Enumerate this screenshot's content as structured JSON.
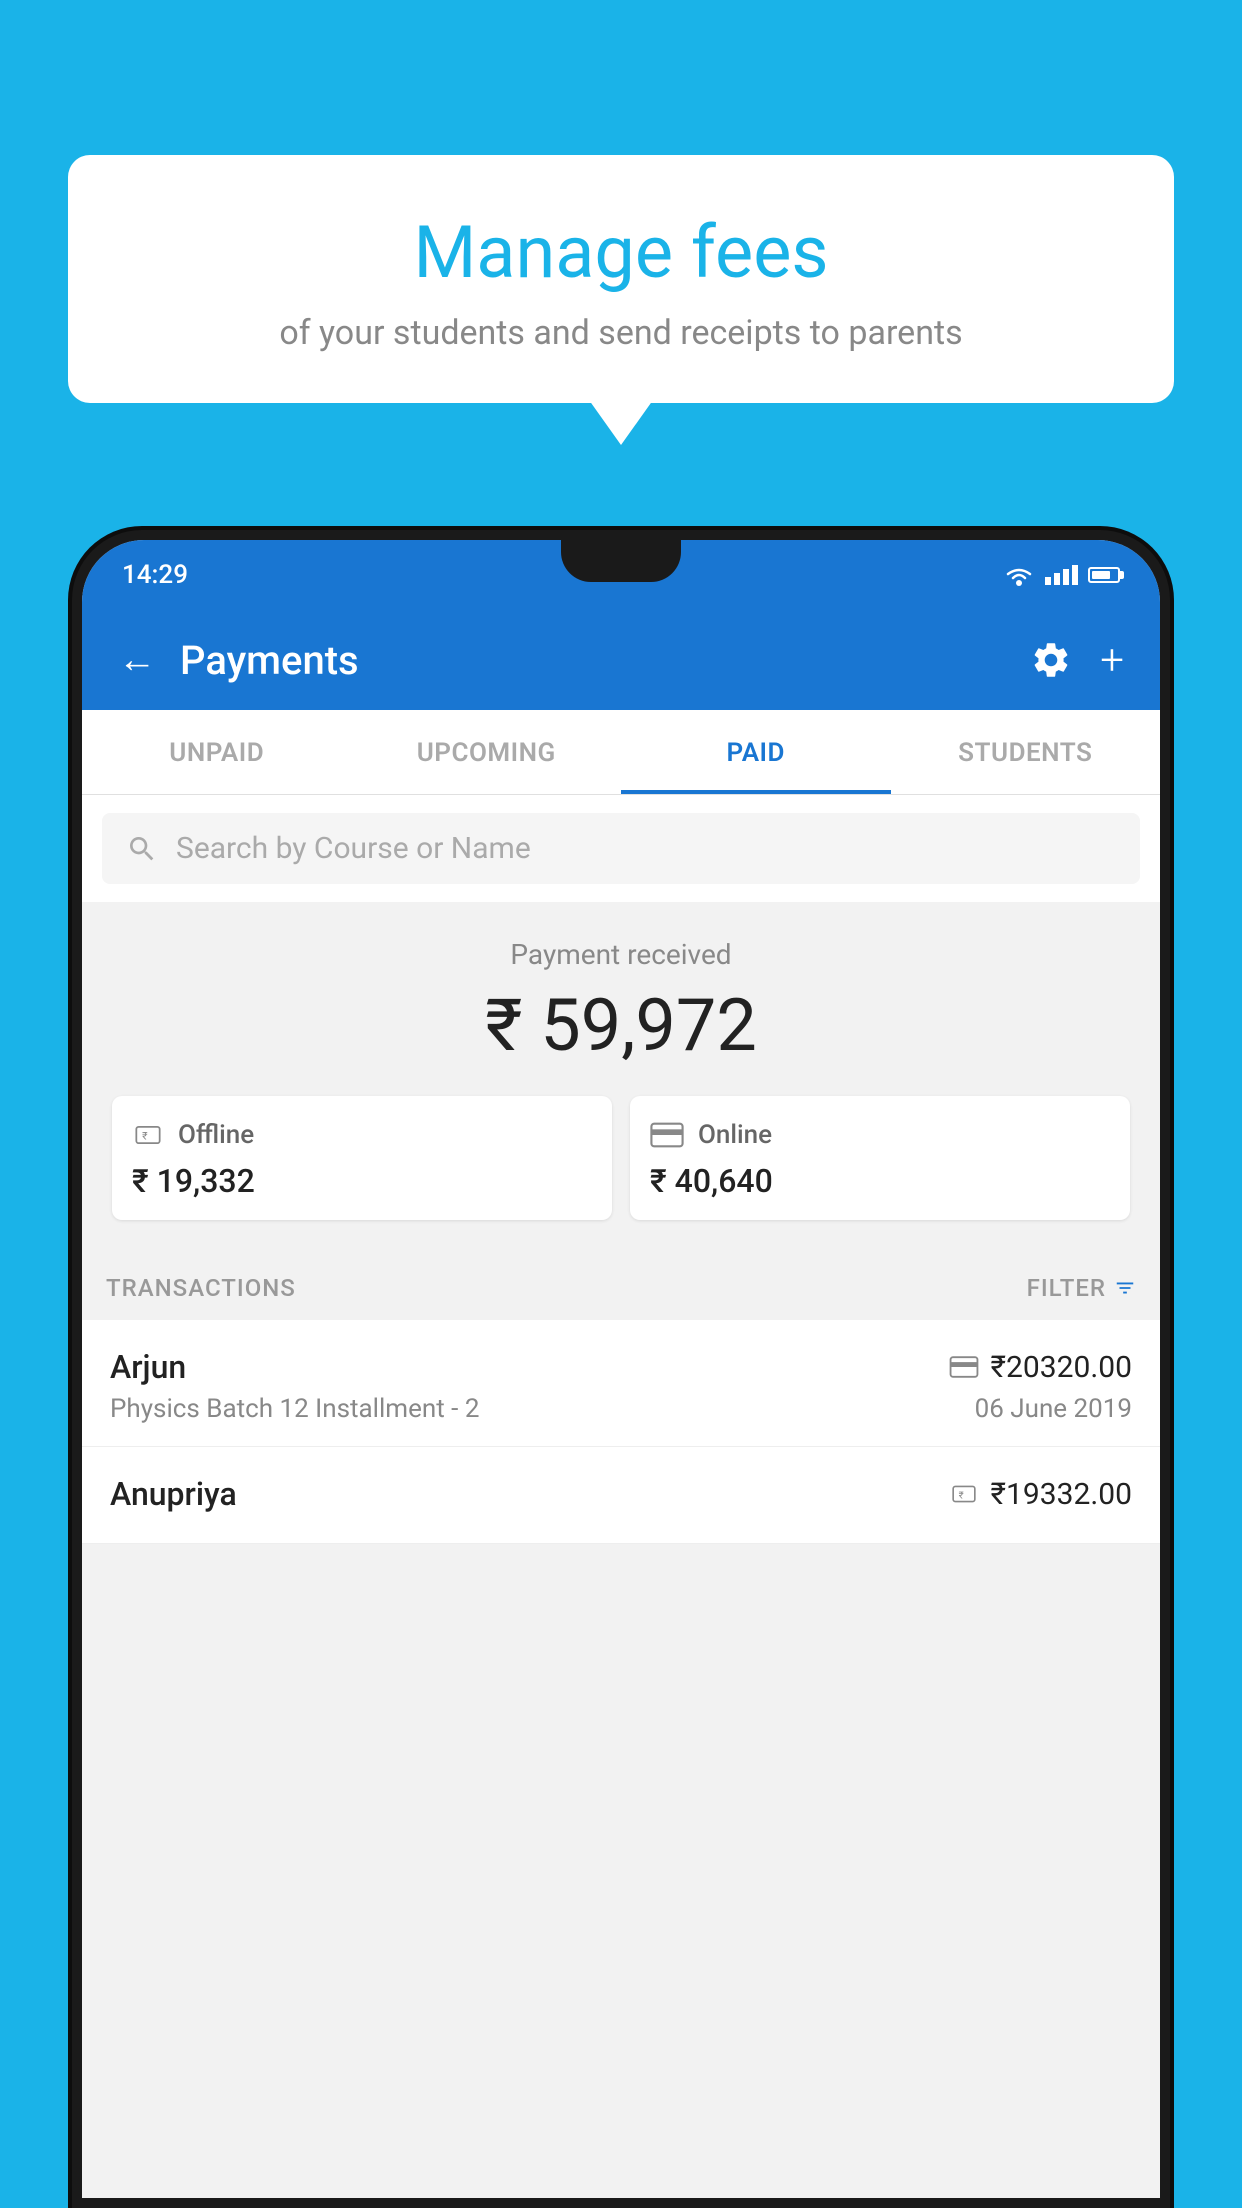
{
  "background_color": "#1ab3e8",
  "speech_bubble": {
    "title": "Manage fees",
    "subtitle": "of your students and send receipts to parents"
  },
  "status_bar": {
    "time": "14:29",
    "wifi_icon": "wifi",
    "signal_icon": "signal",
    "battery_icon": "battery"
  },
  "app_header": {
    "back_label": "←",
    "title": "Payments",
    "gear_icon": "gear",
    "plus_icon": "+"
  },
  "tabs": [
    {
      "label": "UNPAID",
      "active": false
    },
    {
      "label": "UPCOMING",
      "active": false
    },
    {
      "label": "PAID",
      "active": true
    },
    {
      "label": "STUDENTS",
      "active": false
    }
  ],
  "search": {
    "placeholder": "Search by Course or Name"
  },
  "payment_summary": {
    "label": "Payment received",
    "total_amount": "₹ 59,972",
    "offline": {
      "label": "Offline",
      "amount": "₹ 19,332"
    },
    "online": {
      "label": "Online",
      "amount": "₹ 40,640"
    }
  },
  "transactions_section": {
    "label": "TRANSACTIONS",
    "filter_label": "FILTER"
  },
  "transactions": [
    {
      "name": "Arjun",
      "course": "Physics Batch 12 Installment - 2",
      "amount": "₹20320.00",
      "date": "06 June 2019",
      "payment_type": "online"
    },
    {
      "name": "Anupriya",
      "course": "",
      "amount": "₹19332.00",
      "date": "",
      "payment_type": "offline"
    }
  ]
}
